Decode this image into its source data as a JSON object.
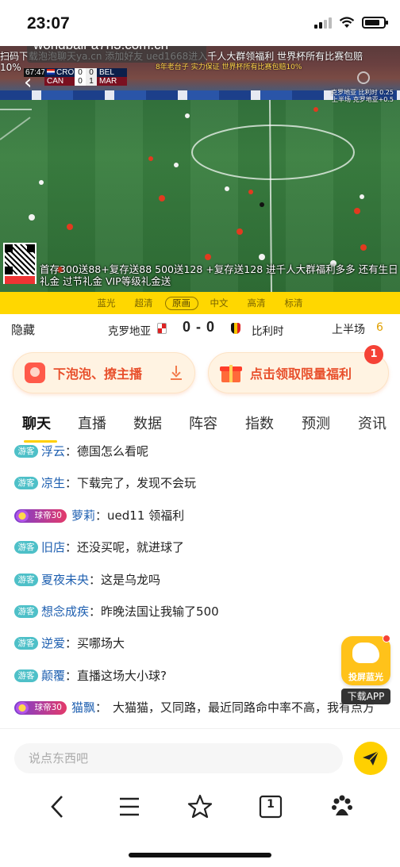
{
  "status_bar": {
    "time": "23:07"
  },
  "video": {
    "url_banner": "worldball-a7h3.com.cn",
    "marquee_top_line1": "扫码下载泡泡聊天ya.cn 添加好友 ued1668进入千人大群领福利 世界杯所有比赛包赔",
    "marquee_top_line2": "10%",
    "scoreboard": {
      "time": "67:47",
      "home_code": "CRO",
      "home_score": "0",
      "away_code": "BEL",
      "away_score": "0",
      "row2_home": "CAN",
      "row2_home_score": "0",
      "row2_away_score": "1",
      "row2_away": "MAR"
    },
    "ad_yellow_line1": "8年老台子 实力保证 世界杯所有比赛包赔10%",
    "ad_right_line1": "克罗地亚 比利时 0.25",
    "ad_right_line2": "上半场 克罗地亚+0.5",
    "marquee_bottom": "首存300送88+复存送88 500送128 +复存送128 进千人大群福利多多 还有生日礼金 过节礼金 VIP等级礼金送"
  },
  "quality_bar": {
    "options": [
      "蓝光",
      "超清",
      "原画",
      "中文",
      "高清",
      "标清"
    ],
    "selected_index": 2
  },
  "match": {
    "hide_label": "隐藏",
    "home_team": "克罗地亚",
    "score": "0 - 0",
    "away_team": "比利时",
    "period": "上半场",
    "period_number": "6"
  },
  "actions": {
    "download_label": "下泡泡、撩主播",
    "welfare_label": "点击领取限量福利",
    "welfare_badge": "1"
  },
  "tabs": [
    "聊天",
    "直播",
    "数据",
    "阵容",
    "指数",
    "预测",
    "资讯"
  ],
  "chat": {
    "messages": [
      {
        "badge": "游客",
        "user": "浮云",
        "text": "德国怎么看呢"
      },
      {
        "badge": "游客",
        "user": "凉生",
        "text": "下载完了，发现不会玩"
      },
      {
        "badge": "球帝30",
        "user": "萝莉",
        "text": "ued11 领福利"
      },
      {
        "badge": "游客",
        "user": "旧店",
        "text": "还没买呢，就进球了"
      },
      {
        "badge": "游客",
        "user": "夏夜未央",
        "text": "这是乌龙吗"
      },
      {
        "badge": "游客",
        "user": "想念成疾",
        "text": "昨晚法国让我输了500"
      },
      {
        "badge": "游客",
        "user": "逆爱",
        "text": "买哪场大"
      },
      {
        "badge": "游客",
        "user": "颠覆",
        "text": "直播这场大小球?"
      },
      {
        "badge": "球帝30",
        "user": "猫飘",
        "text": "大猫猫，又同路，最近同路命中率不高，我有点方"
      }
    ]
  },
  "floating_app": {
    "icon_text": "投屏蓝光",
    "label": "下载APP"
  },
  "input": {
    "placeholder": "说点东西吧"
  },
  "browser_bar": {
    "tab_count": "1"
  }
}
